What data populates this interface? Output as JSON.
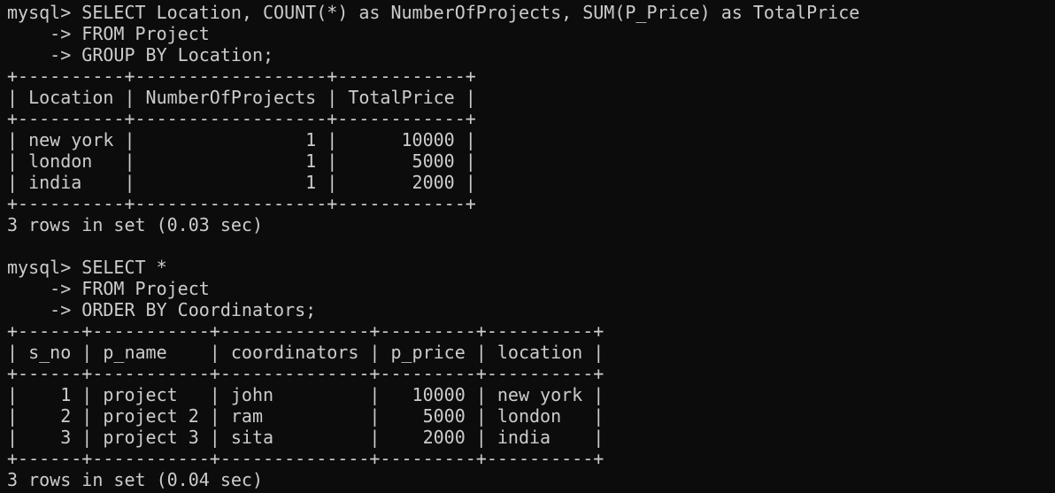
{
  "terminal": {
    "lines": [
      "mysql> SELECT Location, COUNT(*) as NumberOfProjects, SUM(P_Price) as TotalPrice",
      "    -> FROM Project",
      "    -> GROUP BY Location;",
      "+----------+------------------+------------+",
      "| Location | NumberOfProjects | TotalPrice |",
      "+----------+------------------+------------+",
      "| new york |                1 |      10000 |",
      "| london   |                1 |       5000 |",
      "| india    |                1 |       2000 |",
      "+----------+------------------+------------+",
      "3 rows in set (0.03 sec)",
      "",
      "mysql> SELECT *",
      "    -> FROM Project",
      "    -> ORDER BY Coordinators;",
      "+------+-----------+--------------+---------+----------+",
      "| s_no | p_name    | coordinators | p_price | location |",
      "+------+-----------+--------------+---------+----------+",
      "|    1 | project   | john         |   10000 | new york |",
      "|    2 | project 2 | ram          |    5000 | london   |",
      "|    3 | project 3 | sita         |    2000 | india    |",
      "+------+-----------+--------------+---------+----------+",
      "3 rows in set (0.04 sec)"
    ]
  }
}
